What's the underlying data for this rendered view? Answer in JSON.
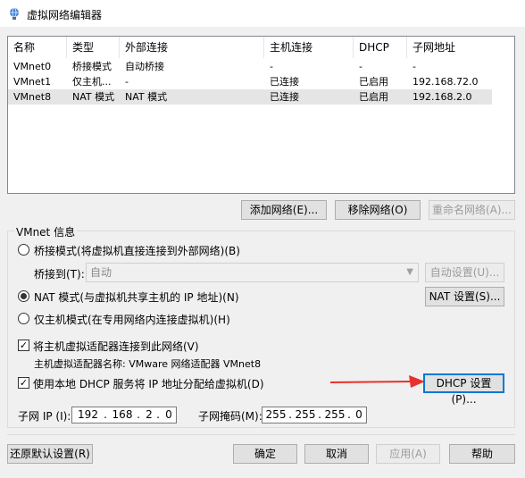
{
  "window": {
    "title": "虚拟网络编辑器"
  },
  "table": {
    "columns": [
      "名称",
      "类型",
      "外部连接",
      "主机连接",
      "DHCP",
      "子网地址"
    ],
    "rows": [
      [
        "VMnet0",
        "桥接模式",
        "自动桥接",
        "-",
        "-",
        "-"
      ],
      [
        "VMnet1",
        "仅主机...",
        "-",
        "已连接",
        "已启用",
        "192.168.72.0"
      ],
      [
        "VMnet8",
        "NAT 模式",
        "NAT 模式",
        "已连接",
        "已启用",
        "192.168.2.0"
      ]
    ],
    "selected_row": "VMnet8"
  },
  "list_buttons": {
    "add": "添加网络(E)...",
    "remove": "移除网络(O)",
    "rename": "重命名网络(A)..."
  },
  "vmnet_info": {
    "group_label": "VMnet 信息",
    "bridged_radio": "桥接模式(将虚拟机直接连接到外部网络)(B)",
    "bridged_to_label": "桥接到(T):",
    "bridged_to_value": "自动",
    "auto_settings": "自动设置(U)...",
    "nat_radio": "NAT 模式(与虚拟机共享主机的 IP 地址)(N)",
    "nat_settings": "NAT 设置(S)...",
    "hostonly_radio": "仅主机模式(在专用网络内连接虚拟机)(H)",
    "connect_adapter_check": "将主机虚拟适配器连接到此网络(V)",
    "adapter_name_line": "主机虚拟适配器名称: VMware 网络适配器 VMnet8",
    "dhcp_check": "使用本地 DHCP 服务将 IP 地址分配给虚拟机(D)",
    "dhcp_settings": "DHCP 设置(P)...",
    "subnet_ip_label": "子网 IP (I):",
    "subnet_ip": [
      "192",
      "168",
      "2",
      "0"
    ],
    "subnet_mask_label": "子网掩码(M):",
    "subnet_mask": [
      "255",
      "255",
      "255",
      "0"
    ],
    "selected_mode": "nat",
    "connect_adapter_checked": true,
    "dhcp_checked": true
  },
  "footer": {
    "restore": "还原默认设置(R)",
    "ok": "确定",
    "cancel": "取消",
    "apply": "应用(A)",
    "help": "帮助"
  },
  "annotation": {
    "arrow_color": "#e8312b",
    "points_to": "dhcp-settings-button"
  },
  "icons": {
    "app": "network-globe-icon",
    "check": "checkmark-icon",
    "combo": "chevron-down-icon",
    "arrow": "red-arrow-icon"
  }
}
